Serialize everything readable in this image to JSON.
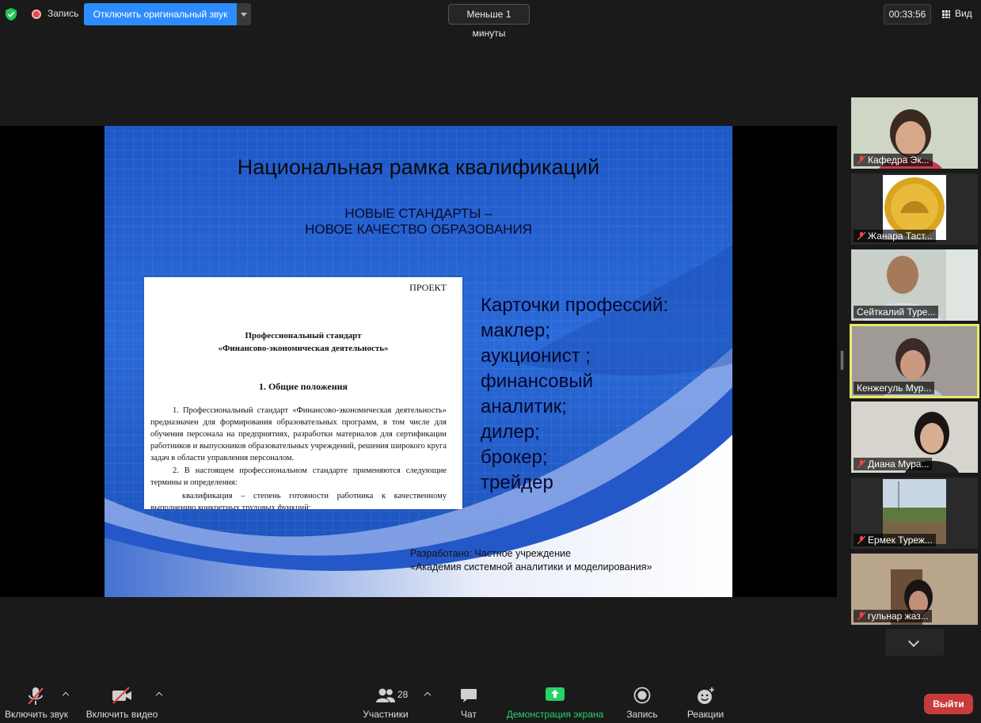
{
  "topbar": {
    "record_label": "Запись",
    "original_sound_button": "Отключить оригинальный звук",
    "timer_label": "Меньше 1 минуты",
    "elapsed": "00:33:56",
    "view_label": "Вид"
  },
  "slide": {
    "title": "Национальная рамка квалификаций",
    "subtitle_line1": "НОВЫЕ СТАНДАРТЫ –",
    "subtitle_line2": "НОВОЕ КАЧЕСТВО ОБРАЗОВАНИЯ",
    "document": {
      "stamp": "ПРОЕКТ",
      "heading_line1": "Профессиональный стандарт",
      "heading_line2": "«Финансово-экономическая деятельность»",
      "section": "1.  Общие положения",
      "paragraph1": "1.     Профессиональный     стандарт     «Финансово-экономическая деятельность» предназначен для формирования образовательных программ, в том числе для обучения персонала на предприятиях, разработки материалов для сертификации работников и выпускников образовательных учреждений, решения широкого круга задач в области управления персоналом.",
      "paragraph2": "2. В настоящем профессиональном стандарте применяются следующие термины и определения:",
      "paragraph3": "квалификация – степень готовности работника к качественному выполнению конкретных трудовых функций;"
    },
    "cards_lines": [
      "Карточки профессий:",
      "маклер;",
      "аукционист ;",
      "финансовый",
      "аналитик;",
      "дилер;",
      "брокер;",
      "трейдер"
    ],
    "developer_line1": "Разработано: Частное учреждение",
    "developer_line2": "«Академия системной аналитики и моделирования»"
  },
  "participants": [
    {
      "name": "Кафедра Эк...",
      "muted": true
    },
    {
      "name": "Жанара Таст...",
      "muted": true
    },
    {
      "name": "Сейткалий Туре...",
      "muted": false
    },
    {
      "name": "Кенжегуль Мур...",
      "muted": false,
      "active_speaker": true
    },
    {
      "name": "Диана Мура...",
      "muted": true
    },
    {
      "name": "Ермек Туреж...",
      "muted": true
    },
    {
      "name": "гульнар жаз...",
      "muted": true
    }
  ],
  "toolbar": {
    "unmute": "Включить звук",
    "start_video": "Включить видео",
    "participants": "Участники",
    "participants_count": "28",
    "chat": "Чат",
    "share_screen": "Демонстрация экрана",
    "record": "Запись",
    "reactions": "Реакции",
    "leave": "Выйти"
  },
  "colors": {
    "accent_blue": "#2d8cff",
    "share_green": "#25d366",
    "leave_red": "#c93a3a",
    "active_speaker": "#e8e86a"
  }
}
